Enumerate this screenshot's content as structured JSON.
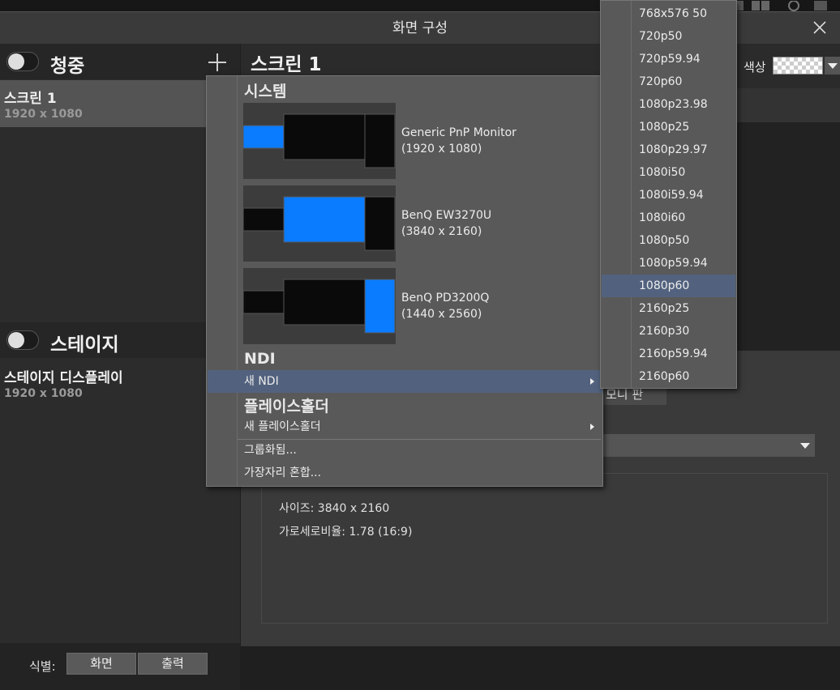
{
  "window": {
    "title": "화면 구성"
  },
  "left": {
    "audience": {
      "title": "청중",
      "items": [
        {
          "name": "스크린 1",
          "res": "1920 x 1080"
        }
      ]
    },
    "stage": {
      "title": "스테이지",
      "items": [
        {
          "name": "스테이지 디스플레이",
          "res": "1920 x 1080"
        }
      ]
    },
    "identify": {
      "label": "식별:",
      "screen_btn": "화면",
      "output_btn": "출력"
    }
  },
  "right": {
    "screen_title": "스크린 1",
    "color_label": "색상",
    "size_info": "사이즈: 3840 x 2160",
    "aspect_info": "가로세로비율: 1.78 (16:9)",
    "partial_tab": "모니 판"
  },
  "menu": {
    "system_header": "시스템",
    "monitors": [
      {
        "name": "Generic PnP Monitor",
        "res": "(1920 x 1080)"
      },
      {
        "name": "BenQ EW3270U",
        "res": "(3840 x 2160)"
      },
      {
        "name": "BenQ PD3200Q",
        "res": "(1440 x 2560)"
      }
    ],
    "ndi_header": "NDI",
    "new_ndi": "새 NDI",
    "placeholder_header": "플레이스홀더",
    "new_placeholder": "새 플레이스홀더",
    "grouped": "그룹화됨...",
    "edge_blend": "가장자리 혼합..."
  },
  "submenu": {
    "items": [
      "768x576 50",
      "720p50",
      "720p59.94",
      "720p60",
      "1080p23.98",
      "1080p25",
      "1080p29.97",
      "1080i50",
      "1080i59.94",
      "1080i60",
      "1080p50",
      "1080p59.94",
      "1080p60",
      "2160p25",
      "2160p30",
      "2160p59.94",
      "2160p60"
    ],
    "selected": "1080p60"
  },
  "colors": {
    "accent_blue": "#0a7cff",
    "highlight": "#52627e"
  }
}
